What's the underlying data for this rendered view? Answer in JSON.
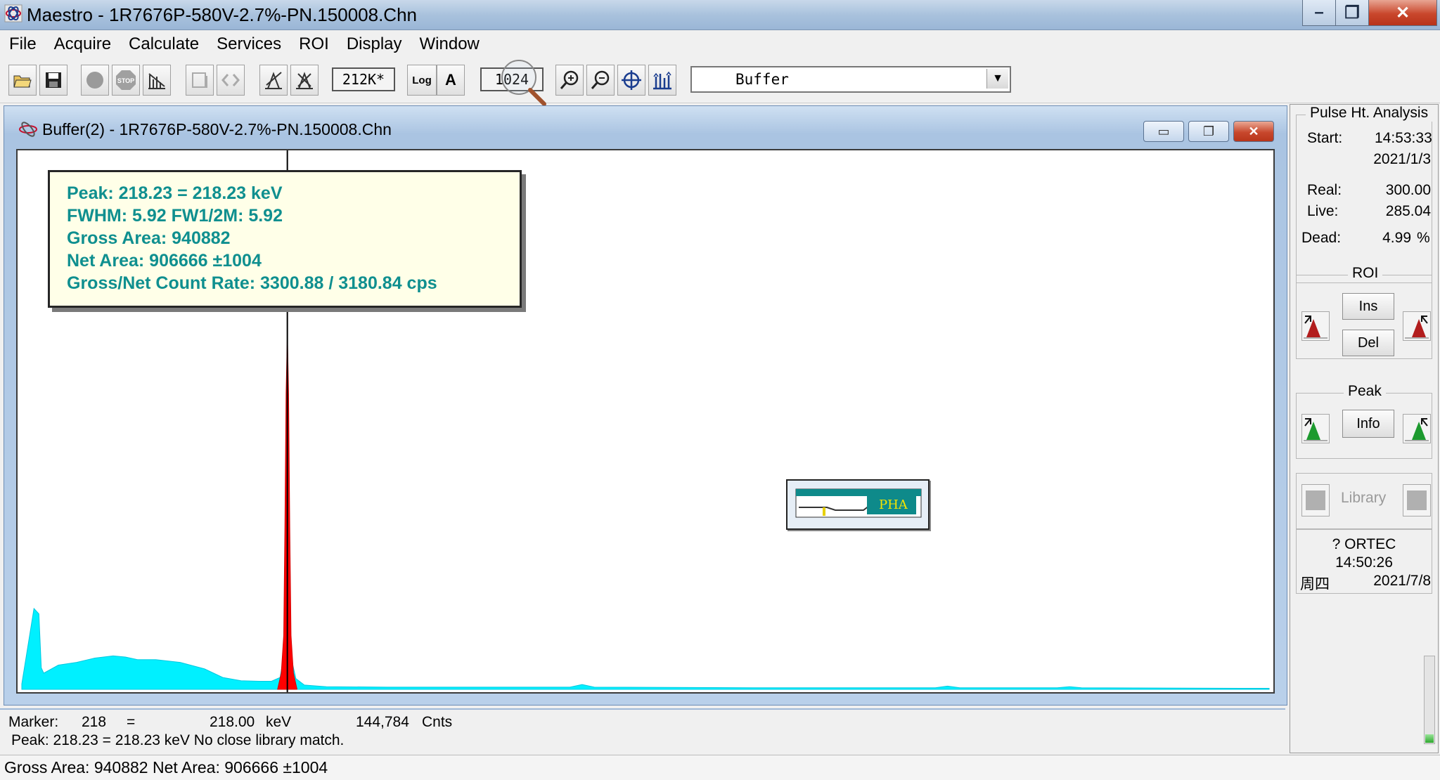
{
  "window": {
    "title": "Maestro - 1R7676P-580V-2.7%-PN.150008.Chn",
    "controls": [
      "–",
      "❐",
      "✕"
    ]
  },
  "menu": [
    "File",
    "Acquire",
    "Calculate",
    "Services",
    "ROI",
    "Display",
    "Window"
  ],
  "toolbar": {
    "scale_value": "212K*",
    "log_label": "Log",
    "auto_label": "A",
    "horizontal_value": "1024",
    "detector_selected": "Buffer"
  },
  "spectrum_window": {
    "title": "Buffer(2) - 1R7676P-580V-2.7%-PN.150008.Chn"
  },
  "peak_info": {
    "line1": "Peak: 218.23 = 218.23 keV",
    "line2": "FWHM: 5.92  FW1/2M: 5.92",
    "line3": "Gross Area: 940882",
    "line4": "Net Area: 906666 ±1004",
    "line5": "Gross/Net Count Rate: 3300.88 / 3180.84 cps"
  },
  "pha_icon_label": "PHA",
  "chart_data": {
    "type": "area",
    "x_range": [
      0,
      1024
    ],
    "peak_channel": 218,
    "series": [
      {
        "color": "#00f0ff",
        "x": [
          0,
          10,
          14,
          16,
          18,
          30,
          45,
          60,
          75,
          85,
          95,
          110,
          130,
          150,
          165,
          180,
          195,
          205,
          212,
          215,
          218,
          221,
          225,
          232,
          250,
          300,
          400,
          450,
          460,
          470,
          600,
          750,
          760,
          770,
          850,
          860,
          870,
          1000,
          1024
        ],
        "y_frac": [
          0.01,
          0.15,
          0.14,
          0.04,
          0.03,
          0.045,
          0.05,
          0.058,
          0.062,
          0.06,
          0.055,
          0.055,
          0.05,
          0.038,
          0.022,
          0.016,
          0.015,
          0.015,
          0.022,
          0.06,
          0.66,
          0.06,
          0.02,
          0.008,
          0.005,
          0.004,
          0.004,
          0.004,
          0.009,
          0.004,
          0.003,
          0.003,
          0.006,
          0.003,
          0.003,
          0.005,
          0.003,
          0.002,
          0.002
        ]
      },
      {
        "color": "#ff0000",
        "x": [
          210,
          213,
          215,
          216,
          217,
          218,
          219,
          220,
          221,
          223,
          226
        ],
        "y_frac": [
          0.0,
          0.03,
          0.1,
          0.3,
          0.55,
          0.66,
          0.55,
          0.3,
          0.1,
          0.03,
          0.0
        ]
      }
    ]
  },
  "marker": {
    "label": "Marker:",
    "channel": "218",
    "equals": "=",
    "energy": "218.00",
    "unit": "keV",
    "counts": "144,784",
    "counts_unit": "Cnts",
    "peak_line": "Peak: 218.23 = 218.23 keV  No close library match."
  },
  "status_bar": "Gross Area: 940882  Net Area: 906666 ±1004",
  "right_panel": {
    "pha_title": "Pulse Ht. Analysis",
    "start_label": "Start:",
    "start_time": "14:53:33",
    "start_date": "2021/1/3",
    "real_label": "Real:",
    "real_value": "300.00",
    "live_label": "Live:",
    "live_value": "285.04",
    "dead_label": "Dead:",
    "dead_value": "4.99",
    "dead_unit": "%",
    "roi_title": "ROI",
    "ins_label": "Ins",
    "del_label": "Del",
    "peak_title": "Peak",
    "info_label": "Info",
    "library_label": "Library",
    "ortec": "? ORTEC",
    "clock_time": "14:50:26",
    "weekday": "周四",
    "clock_date": "2021/7/8",
    "progress_fraction": 0.1
  }
}
